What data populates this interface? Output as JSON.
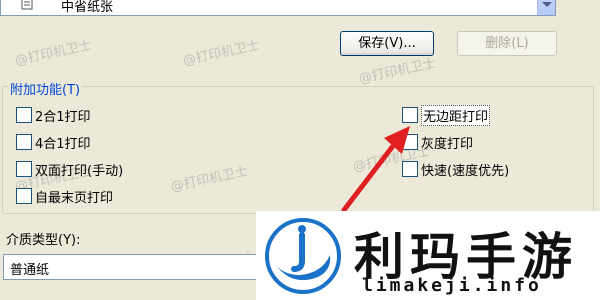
{
  "paper_source": {
    "value": "中省纸张"
  },
  "buttons": {
    "save": "保存(V)...",
    "delete": "删除(L)"
  },
  "additional_features": {
    "title": "附加功能(T)",
    "options": [
      {
        "label": "2合1打印",
        "checked": false
      },
      {
        "label": "4合1打印",
        "checked": false
      },
      {
        "label": "双面打印(手动)",
        "checked": false
      },
      {
        "label": "自最末页打印",
        "checked": false
      },
      {
        "label": "无边距打印",
        "checked": false
      },
      {
        "label": "灰度打印",
        "checked": false
      },
      {
        "label": "快速(速度优先)",
        "checked": false
      }
    ]
  },
  "media_type": {
    "label": "介质类型(Y):",
    "value": "普通纸"
  },
  "watermark": "@打印机卫士",
  "brand": {
    "name": "利玛手游",
    "domain": "limakeji.info"
  },
  "colors": {
    "group_title": "#0046d5",
    "arrow": "#e02020",
    "dialog_bg": "#ece9d8"
  }
}
